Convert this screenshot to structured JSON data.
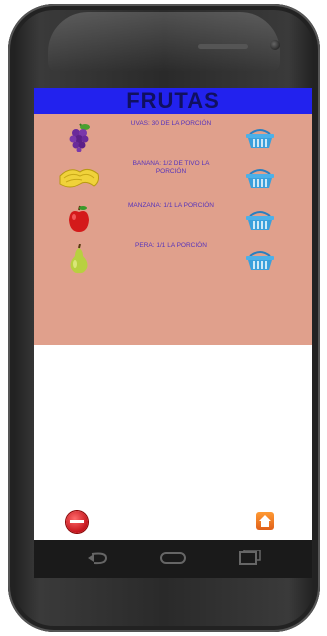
{
  "app": {
    "title": "FRUTAS"
  },
  "items": [
    {
      "icon": "grapes-icon",
      "label": "UVAS: 30 DE LA PORCIÓN",
      "name": "grapes"
    },
    {
      "icon": "banana-icon",
      "label": "BANANA: 1/2 DE TIVO LA PORCIÓN",
      "name": "banana"
    },
    {
      "icon": "apple-icon",
      "label": "MANZANA: 1/1 LA PORCIÓN",
      "name": "apple"
    },
    {
      "icon": "pear-icon",
      "label": "PERA: 1/1 LA PORCIÓN",
      "name": "pear"
    }
  ],
  "colors": {
    "banner": "#2222ee",
    "panel": "#e0a08c",
    "label": "#5533bb"
  },
  "nav": {
    "back": "back-icon",
    "home": "home-icon",
    "recents": "recents-icon"
  }
}
